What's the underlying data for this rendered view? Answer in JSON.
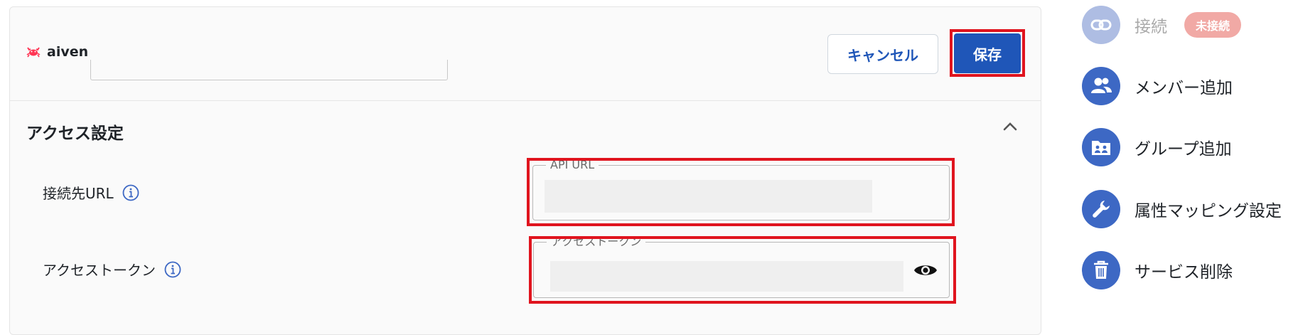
{
  "brand": {
    "name": "aiven"
  },
  "toolbar": {
    "cancel_label": "キャンセル",
    "save_label": "保存"
  },
  "access": {
    "title": "アクセス設定",
    "url_label": "接続先URL",
    "url_field_legend": "API URL",
    "token_label": "アクセストークン",
    "token_field_legend": "アクセストークン"
  },
  "sidebar": {
    "items": [
      {
        "label": "接続",
        "icon": "link-icon",
        "badge": "未接続",
        "state": "disabled"
      },
      {
        "label": "メンバー追加",
        "icon": "users-icon"
      },
      {
        "label": "グループ追加",
        "icon": "group-folder-icon"
      },
      {
        "label": "属性マッピング設定",
        "icon": "wrench-icon"
      },
      {
        "label": "サービス削除",
        "icon": "trash-icon"
      }
    ]
  },
  "colors": {
    "primary": "#1f56b8",
    "highlight": "#e0141e",
    "sidebar_icon_bg": "#3d68c4",
    "badge_bg": "#f1a9a5"
  }
}
